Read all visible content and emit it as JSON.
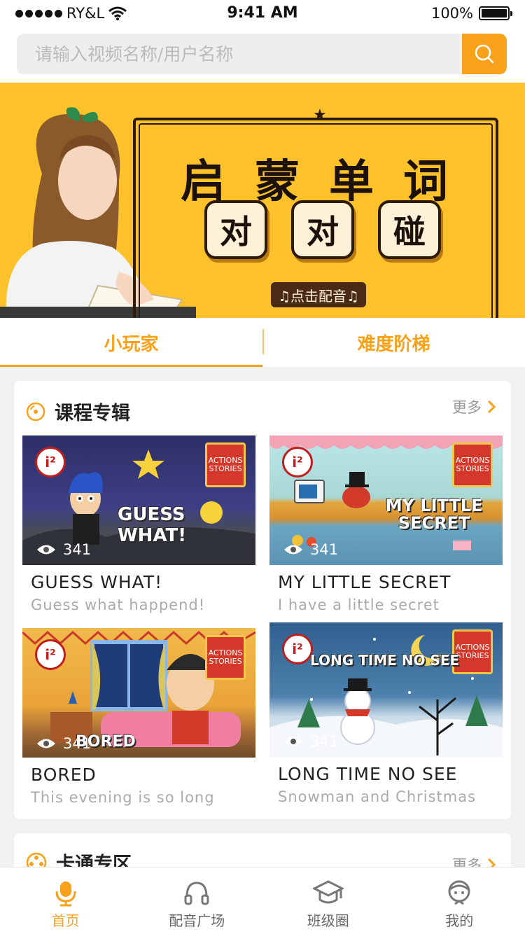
{
  "status_bar": {
    "carrier": "RY&L",
    "time": "9:41 AM",
    "battery": "100%"
  },
  "search": {
    "placeholder": "请输入视频名称/用户名称",
    "value": "",
    "button_icon": "search-icon"
  },
  "banner": {
    "title_chars": [
      "启",
      "蒙",
      "单",
      "词"
    ],
    "tile_chars": [
      "对",
      "对",
      "碰"
    ],
    "cta": "♫点击配音♫"
  },
  "tabs": [
    {
      "label": "小玩家",
      "active": true
    },
    {
      "label": "难度阶梯",
      "active": false
    }
  ],
  "course_section": {
    "title": "课程专辑",
    "more": "更多",
    "videos": [
      {
        "title": "GUESS WHAT!",
        "subtitle": "Guess what happend!",
        "views": "341",
        "art_text": "GUESS WHAT!",
        "book_text": "ACTIONS STORIES"
      },
      {
        "title": "MY LITTLE SECRET",
        "subtitle": "I have a little secret",
        "views": "341",
        "art_text": "MY LITTLE SECRET",
        "book_text": "ACTIONS STORIES"
      },
      {
        "title": "BORED",
        "subtitle": "This evening is so long",
        "views": "341",
        "art_text": "BORED",
        "book_text": "ACTIONS STORIES"
      },
      {
        "title": "LONG TIME NO SEE",
        "subtitle": "Snowman and Christmas",
        "views": "341",
        "art_text": "LONG TIME NO SEE",
        "book_text": "ACTIONS STORIES"
      }
    ]
  },
  "cartoon_section": {
    "title": "卡通专区",
    "more": "更多"
  },
  "tab_bar": [
    {
      "label": "首页",
      "icon": "microphone-icon",
      "active": true
    },
    {
      "label": "配音广场",
      "icon": "headphones-icon",
      "active": false
    },
    {
      "label": "班级圈",
      "icon": "graduation-cap-icon",
      "active": false
    },
    {
      "label": "我的",
      "icon": "user-icon",
      "active": false
    }
  ],
  "colors": {
    "accent": "#f8a21b",
    "banner_bg": "#fcc12b",
    "text_muted": "#aaaaaa"
  }
}
